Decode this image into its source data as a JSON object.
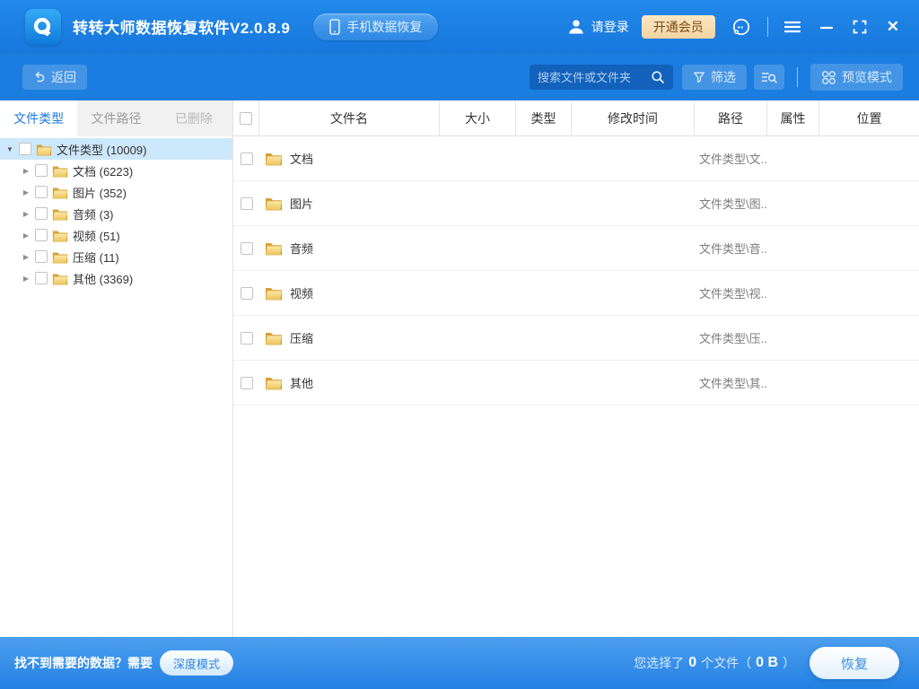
{
  "app": {
    "title": "转转大师数据恢复软件V2.0.8.9",
    "phone_recovery_label": "手机数据恢复",
    "login_label": "请登录",
    "vip_label": "开通会员"
  },
  "toolbar": {
    "back_label": "返回",
    "search_placeholder": "搜索文件或文件夹",
    "filter_label": "筛选",
    "preview_label": "预览模式"
  },
  "sidebar": {
    "tabs": [
      {
        "label": "文件类型",
        "active": true
      },
      {
        "label": "文件路径",
        "active": false
      },
      {
        "label": "已删除",
        "active": false
      }
    ],
    "tree": {
      "root": {
        "label": "文件类型 (10009)",
        "expanded": true,
        "selected": true
      },
      "items": [
        {
          "label": "文档 (6223)"
        },
        {
          "label": "图片 (352)"
        },
        {
          "label": "音频 (3)"
        },
        {
          "label": "视频 (51)"
        },
        {
          "label": "压缩 (11)"
        },
        {
          "label": "其他 (3369)"
        }
      ]
    }
  },
  "table": {
    "columns": [
      "文件名",
      "大小",
      "类型",
      "修改时间",
      "路径",
      "属性",
      "位置"
    ],
    "rows": [
      {
        "name": "文档",
        "path": "文件类型\\文..."
      },
      {
        "name": "图片",
        "path": "文件类型\\图..."
      },
      {
        "name": "音频",
        "path": "文件类型\\音..."
      },
      {
        "name": "视频",
        "path": "文件类型\\视..."
      },
      {
        "name": "压缩",
        "path": "文件类型\\压..."
      },
      {
        "name": "其他",
        "path": "文件类型\\其..."
      }
    ]
  },
  "footer": {
    "hint_text": "找不到需要的数据？需要",
    "deep_mode_label": "深度模式",
    "selection_prefix": "您选择了",
    "selection_count": "0",
    "selection_middle": "个文件（",
    "selection_size": "0 B",
    "selection_suffix": "）",
    "recover_label": "恢复"
  },
  "icons": {
    "expanded_arrow": "▼",
    "collapsed_arrow": "▶",
    "close_glyph": "✕"
  },
  "colors": {
    "accent_blue": "#1a7ae0",
    "titlebar_blue": "#1777dc",
    "vip_bg": "#f6dcb0",
    "vip_text": "#7d4b14",
    "selected_row_bg": "#cde8fb",
    "folder_yellow": "#f0c95c"
  }
}
